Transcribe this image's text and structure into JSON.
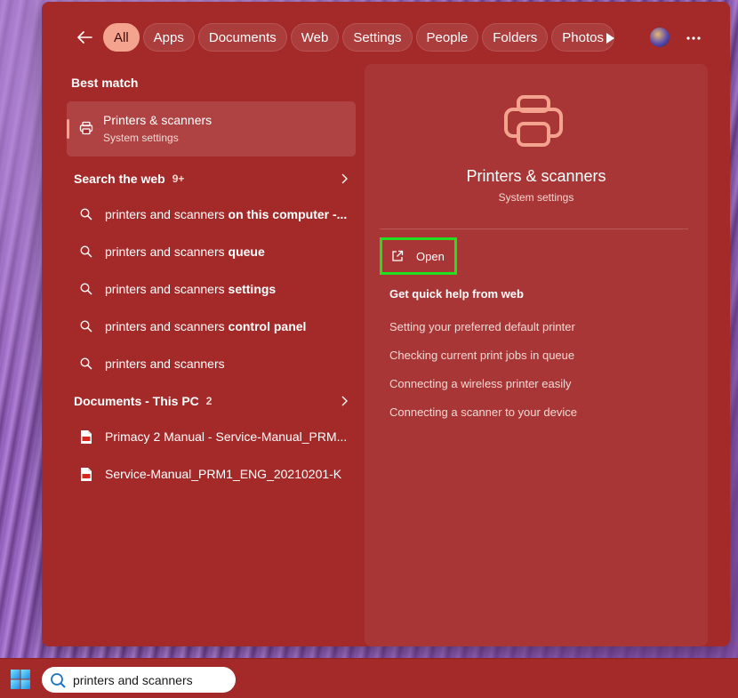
{
  "tabs": [
    {
      "label": "All",
      "active": true
    },
    {
      "label": "Apps"
    },
    {
      "label": "Documents"
    },
    {
      "label": "Web"
    },
    {
      "label": "Settings"
    },
    {
      "label": "People"
    },
    {
      "label": "Folders"
    },
    {
      "label": "Photos"
    }
  ],
  "best_match": {
    "section_title": "Best match",
    "title": "Printers & scanners",
    "subtitle": "System settings"
  },
  "search_web": {
    "header": "Search the web",
    "count": "9+",
    "items": [
      {
        "plain": "printers and scanners ",
        "bold": "on this computer -..."
      },
      {
        "plain": "printers and scanners ",
        "bold": "queue"
      },
      {
        "plain": "printers and scanners ",
        "bold": "settings"
      },
      {
        "plain": "printers and scanners ",
        "bold": "control panel"
      },
      {
        "plain": "printers and scanners",
        "bold": ""
      }
    ]
  },
  "documents": {
    "header": "Documents - This PC",
    "count": "2",
    "items": [
      {
        "label": "Primacy 2 Manual - Service-Manual_PRM..."
      },
      {
        "label": "Service-Manual_PRM1_ENG_20210201-K"
      }
    ]
  },
  "preview": {
    "title": "Printers & scanners",
    "subtitle": "System settings",
    "open_label": "Open",
    "help_title": "Get quick help from web",
    "help_links": [
      "Setting your preferred default printer",
      "Checking current print jobs in queue",
      "Connecting a wireless printer easily",
      "Connecting a scanner to your device"
    ]
  },
  "taskbar": {
    "search_value": "printers and scanners"
  },
  "colors": {
    "flyout_bg": "#a42a2a",
    "accent": "#f4a38f",
    "highlight_box": "#22e01e"
  }
}
